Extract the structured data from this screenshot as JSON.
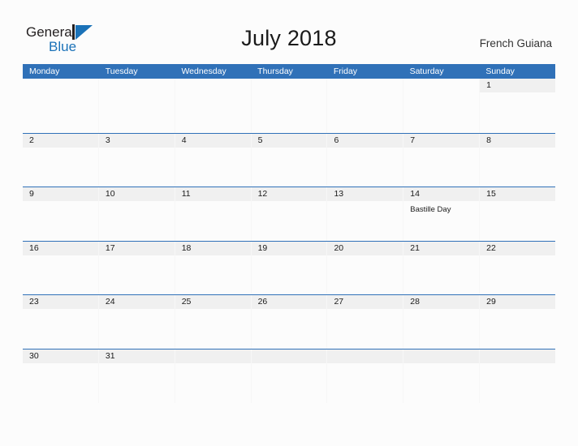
{
  "header": {
    "logo": {
      "name": "general-blue-logo",
      "word_one": "General",
      "word_two": "Blue",
      "mark": "flag-triangle-icon",
      "color_dark": "#231F20",
      "color_blue": "#1B72B8"
    },
    "title": "July 2018",
    "locale": "French Guiana"
  },
  "calendar": {
    "accent_color": "#3071B8",
    "band_color": "#F0F0F0",
    "month": "July",
    "year": "2018",
    "weekday_headers": [
      "Monday",
      "Tuesday",
      "Wednesday",
      "Thursday",
      "Friday",
      "Saturday",
      "Sunday"
    ],
    "weeks": [
      [
        {
          "day": "",
          "event": "",
          "filled": false
        },
        {
          "day": "",
          "event": "",
          "filled": false
        },
        {
          "day": "",
          "event": "",
          "filled": false
        },
        {
          "day": "",
          "event": "",
          "filled": false
        },
        {
          "day": "",
          "event": "",
          "filled": false
        },
        {
          "day": "",
          "event": "",
          "filled": false
        },
        {
          "day": "1",
          "event": "",
          "filled": true
        }
      ],
      [
        {
          "day": "2",
          "event": "",
          "filled": true
        },
        {
          "day": "3",
          "event": "",
          "filled": true
        },
        {
          "day": "4",
          "event": "",
          "filled": true
        },
        {
          "day": "5",
          "event": "",
          "filled": true
        },
        {
          "day": "6",
          "event": "",
          "filled": true
        },
        {
          "day": "7",
          "event": "",
          "filled": true
        },
        {
          "day": "8",
          "event": "",
          "filled": true
        }
      ],
      [
        {
          "day": "9",
          "event": "",
          "filled": true
        },
        {
          "day": "10",
          "event": "",
          "filled": true
        },
        {
          "day": "11",
          "event": "",
          "filled": true
        },
        {
          "day": "12",
          "event": "",
          "filled": true
        },
        {
          "day": "13",
          "event": "",
          "filled": true
        },
        {
          "day": "14",
          "event": "Bastille Day",
          "filled": true
        },
        {
          "day": "15",
          "event": "",
          "filled": true
        }
      ],
      [
        {
          "day": "16",
          "event": "",
          "filled": true
        },
        {
          "day": "17",
          "event": "",
          "filled": true
        },
        {
          "day": "18",
          "event": "",
          "filled": true
        },
        {
          "day": "19",
          "event": "",
          "filled": true
        },
        {
          "day": "20",
          "event": "",
          "filled": true
        },
        {
          "day": "21",
          "event": "",
          "filled": true
        },
        {
          "day": "22",
          "event": "",
          "filled": true
        }
      ],
      [
        {
          "day": "23",
          "event": "",
          "filled": true
        },
        {
          "day": "24",
          "event": "",
          "filled": true
        },
        {
          "day": "25",
          "event": "",
          "filled": true
        },
        {
          "day": "26",
          "event": "",
          "filled": true
        },
        {
          "day": "27",
          "event": "",
          "filled": true
        },
        {
          "day": "28",
          "event": "",
          "filled": true
        },
        {
          "day": "29",
          "event": "",
          "filled": true
        }
      ],
      [
        {
          "day": "30",
          "event": "",
          "filled": true
        },
        {
          "day": "31",
          "event": "",
          "filled": true
        },
        {
          "day": "",
          "event": "",
          "filled": true
        },
        {
          "day": "",
          "event": "",
          "filled": true
        },
        {
          "day": "",
          "event": "",
          "filled": true
        },
        {
          "day": "",
          "event": "",
          "filled": true
        },
        {
          "day": "",
          "event": "",
          "filled": true
        }
      ]
    ]
  }
}
